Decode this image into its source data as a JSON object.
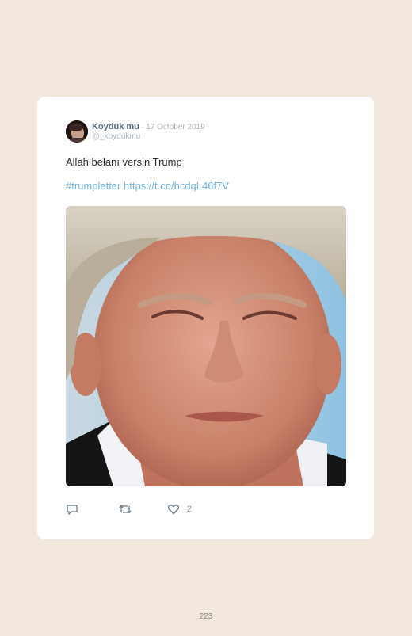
{
  "tweet": {
    "display_name": "Koyduk mu",
    "separator": "·",
    "date": "17 October 2019",
    "handle": "@_koydukmu",
    "text": "Allah belanı versin Trump",
    "hashtag": "#trumpletter",
    "link": "https://t.co/hcdqL46f7V",
    "like_count": "2"
  },
  "icons": {
    "reply": "reply-icon",
    "retweet": "retweet-icon",
    "like": "heart-icon"
  },
  "page": {
    "number": "223"
  },
  "colors": {
    "background": "#f3e8dd",
    "card": "#ffffff",
    "link": "#6fb5e0",
    "name": "#5b6b7a",
    "muted": "#aab4bd"
  }
}
